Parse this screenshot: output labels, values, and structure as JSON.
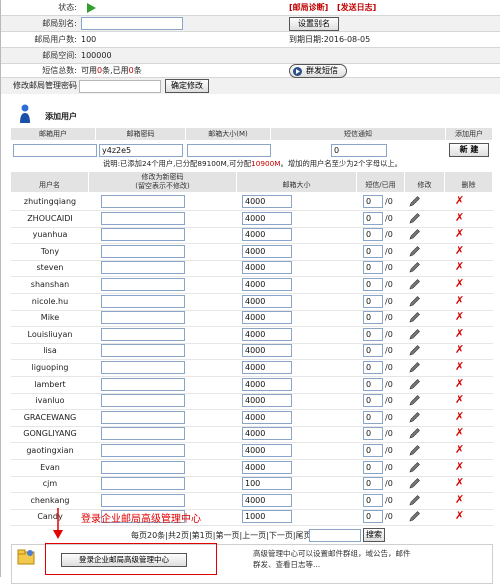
{
  "status_row": {
    "label": "状态:",
    "diag_link": "[邮局诊断]",
    "log_link": "[发送日志]"
  },
  "alias_row": {
    "label": "邮局别名:",
    "value": "",
    "button": "设置别名"
  },
  "users_row": {
    "label": "邮局用户数:",
    "value": "100",
    "expire": "到期日期:2016-08-05"
  },
  "space_row": {
    "label": "邮局空间:",
    "value": "100000"
  },
  "sms_row": {
    "label": "短信总数:",
    "t1": "可用",
    "avail": "0",
    "t2": "条,已用",
    "used": "0",
    "t3": "条",
    "button": "群发短信"
  },
  "pwd_row": {
    "label": "修改邮局管理密码",
    "button": "确定修改"
  },
  "add_user": {
    "title": "添加用户",
    "headers": [
      "邮箱用户",
      "邮箱密码",
      "邮箱大小(M)",
      "短信通知",
      "添加用户"
    ],
    "password": "y4z2e5",
    "sms": "0",
    "button": "新 建",
    "note_a": "说明:已添加24个用户,已分配89100M,可分配",
    "note_val": "10900M",
    "note_b": "。增加的用户名至少为2个字母以上。"
  },
  "table": {
    "headers": {
      "name": "用户名",
      "pwd_line1": "修改为新密码",
      "pwd_line2": "(留空表示不修改)",
      "size": "邮箱大小",
      "sms": "短信/已用",
      "edit": "修改",
      "del": "删除"
    },
    "rows": [
      {
        "name": "zhutingqiang",
        "size": "4000",
        "sms": "0",
        "used": "/0"
      },
      {
        "name": "ZHOUCAIDI",
        "size": "4000",
        "sms": "0",
        "used": "/0"
      },
      {
        "name": "yuanhua",
        "size": "4000",
        "sms": "0",
        "used": "/0"
      },
      {
        "name": "Tony",
        "size": "4000",
        "sms": "0",
        "used": "/0"
      },
      {
        "name": "steven",
        "size": "4000",
        "sms": "0",
        "used": "/0"
      },
      {
        "name": "shanshan",
        "size": "4000",
        "sms": "0",
        "used": "/0"
      },
      {
        "name": "nicole.hu",
        "size": "4000",
        "sms": "0",
        "used": "/0"
      },
      {
        "name": "Mike",
        "size": "4000",
        "sms": "0",
        "used": "/0"
      },
      {
        "name": "Louisliuyan",
        "size": "4000",
        "sms": "0",
        "used": "/0"
      },
      {
        "name": "lisa",
        "size": "4000",
        "sms": "0",
        "used": "/0"
      },
      {
        "name": "liguoping",
        "size": "4000",
        "sms": "0",
        "used": "/0"
      },
      {
        "name": "lambert",
        "size": "4000",
        "sms": "0",
        "used": "/0"
      },
      {
        "name": "ivanluo",
        "size": "4000",
        "sms": "0",
        "used": "/0"
      },
      {
        "name": "GRACEWANG",
        "size": "4000",
        "sms": "0",
        "used": "/0"
      },
      {
        "name": "GONGLIYANG",
        "size": "4000",
        "sms": "0",
        "used": "/0"
      },
      {
        "name": "gaotingxian",
        "size": "4000",
        "sms": "0",
        "used": "/0"
      },
      {
        "name": "Evan",
        "size": "4000",
        "sms": "0",
        "used": "/0"
      },
      {
        "name": "cjm",
        "size": "100",
        "sms": "0",
        "used": "/0"
      },
      {
        "name": "chenkang",
        "size": "4000",
        "sms": "0",
        "used": "/0"
      },
      {
        "name": "Candy",
        "size": "1000",
        "sms": "0",
        "used": "/0"
      }
    ]
  },
  "pager": {
    "text": "每页20条|共2页|第1页|第一页|上一页|下一页|尾页 用户名:",
    "button": "搜索"
  },
  "annotation": "登录企业邮局高级管理中心",
  "bottom": {
    "button": "登录企业邮局高级管理中心",
    "desc1": "高级管理中心可以设置邮件群组，域公告，邮件",
    "desc2": "群发、查看日志等..."
  },
  "colors": {
    "accent_red": "#cc0000",
    "play_green": "#2fa12f",
    "annotation_red": "#e30000"
  }
}
